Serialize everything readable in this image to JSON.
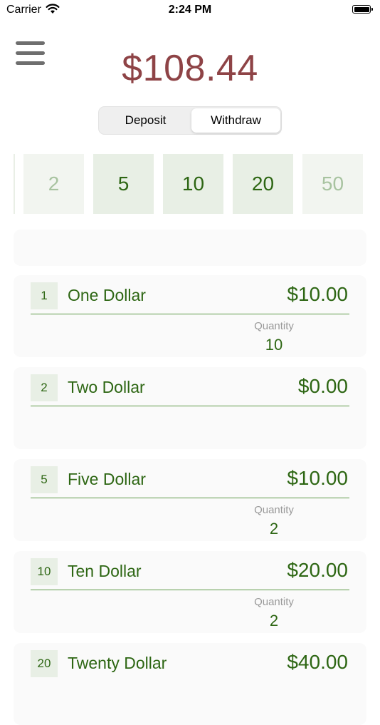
{
  "status_bar": {
    "carrier": "Carrier",
    "time": "2:24 PM"
  },
  "header": {
    "balance": "$108.44"
  },
  "mode_toggle": {
    "deposit_label": "Deposit",
    "withdraw_label": "Withdraw",
    "selected": "Withdraw"
  },
  "denominations": [
    {
      "label": "2",
      "state": "faded"
    },
    {
      "label": "5",
      "state": "active"
    },
    {
      "label": "10",
      "state": "active"
    },
    {
      "label": "20",
      "state": "active"
    },
    {
      "label": "50",
      "state": "faded"
    }
  ],
  "bills": [
    {
      "badge": "1",
      "name": "One Dollar",
      "amount": "$10.00",
      "quantity_label": "Quantity",
      "quantity": "10"
    },
    {
      "badge": "2",
      "name": "Two Dollar",
      "amount": "$0.00"
    },
    {
      "badge": "5",
      "name": "Five Dollar",
      "amount": "$10.00",
      "quantity_label": "Quantity",
      "quantity": "2"
    },
    {
      "badge": "10",
      "name": "Ten Dollar",
      "amount": "$20.00",
      "quantity_label": "Quantity",
      "quantity": "2"
    },
    {
      "badge": "20",
      "name": "Twenty Dollar",
      "amount": "$40.00"
    }
  ],
  "colors": {
    "balance": "#8e4346",
    "accent_green": "#2d6613",
    "denom_bg": "#e8efe5",
    "card_bg": "#fafafa"
  }
}
